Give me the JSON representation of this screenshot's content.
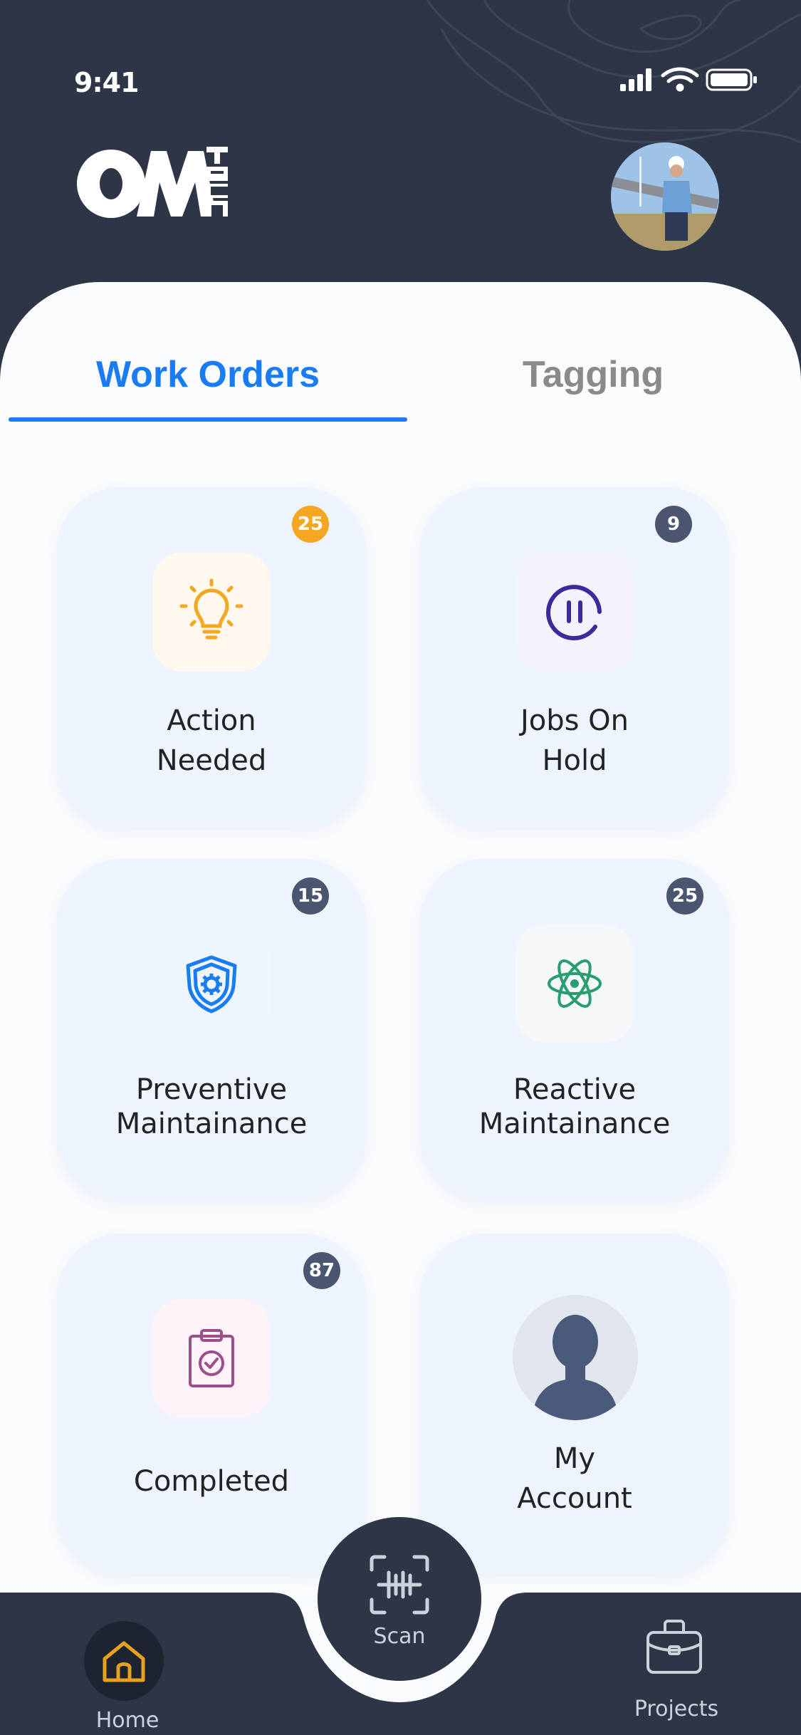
{
  "status_bar": {
    "time": "9:41"
  },
  "brand": {
    "logo_name": "OM TECH logo"
  },
  "tabs": [
    {
      "label": "Work Orders",
      "active": true
    },
    {
      "label": "Tagging",
      "active": false
    }
  ],
  "cards": [
    {
      "label_line1": "Action",
      "label_line2": "Needed",
      "badge": "25",
      "badge_color": "#f5a623",
      "icon": "lightbulb-icon"
    },
    {
      "label_line1": "Jobs On",
      "label_line2": "Hold",
      "badge": "9",
      "badge_color": "#4a5570",
      "icon": "pause-icon"
    },
    {
      "label_line1": "Preventive",
      "label_line2": "Maintainance",
      "badge": "15",
      "badge_color": "#4a5570",
      "icon": "shield-gear-icon"
    },
    {
      "label_line1": "Reactive",
      "label_line2": "Maintainance",
      "badge": "25",
      "badge_color": "#4a5570",
      "icon": "atom-icon"
    },
    {
      "label_line1": "Completed",
      "label_line2": "",
      "badge": "87",
      "badge_color": "#4a5570",
      "icon": "clipboard-check-icon"
    },
    {
      "label_line1": "My",
      "label_line2": "Account",
      "badge": "",
      "badge_color": "",
      "icon": "user-avatar-icon"
    }
  ],
  "bottom_nav": {
    "home": "Home",
    "scan": "Scan",
    "projects": "Projects"
  },
  "colors": {
    "header_bg": "#2d3547",
    "accent_blue": "#1a7cf2",
    "card_bg": "#edf4fe",
    "home_icon": "#e8a020"
  }
}
